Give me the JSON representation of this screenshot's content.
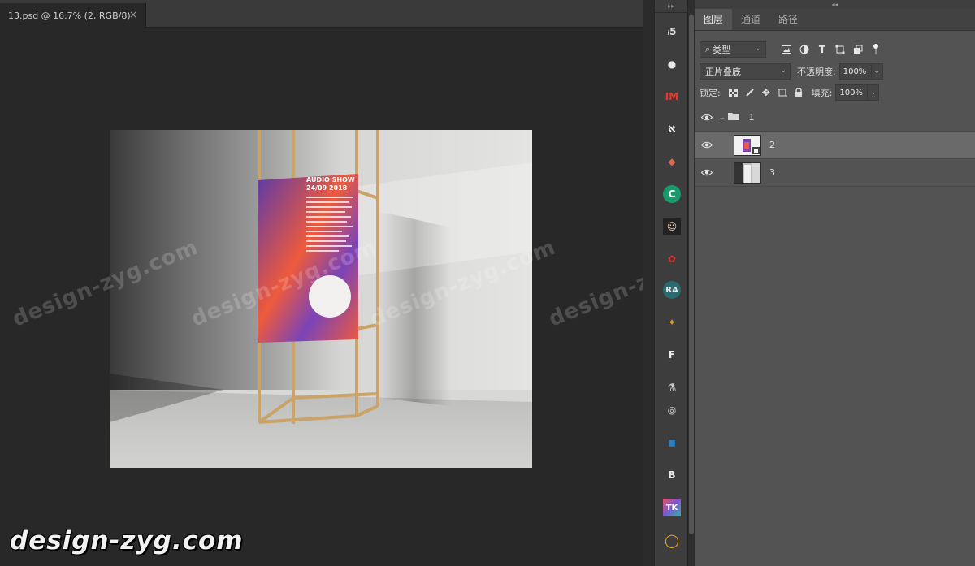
{
  "document": {
    "tab_label": "13.psd @ 16.7% (2, RGB/8)",
    "close_symbol": "×"
  },
  "artwork": {
    "poster_title": "AUDIO SHOW",
    "poster_date": "24/09 2018",
    "poster_colors": {
      "orange": "#ee5a3c",
      "purple": "#5b3aa8"
    }
  },
  "watermarks": {
    "text": "design-zyg.com",
    "main": "design-zyg.com"
  },
  "plugins": [
    {
      "name": "plugin-1",
      "glyph": "ᵢ5"
    },
    {
      "name": "plugin-2",
      "glyph": "●"
    },
    {
      "name": "plugin-im",
      "glyph": "IM"
    },
    {
      "name": "plugin-4",
      "glyph": "ℵ"
    },
    {
      "name": "plugin-5",
      "glyph": "◆"
    },
    {
      "name": "plugin-c",
      "glyph": "C"
    },
    {
      "name": "plugin-7",
      "glyph": "☺"
    },
    {
      "name": "plugin-8",
      "glyph": "✿"
    },
    {
      "name": "plugin-ra",
      "glyph": "RA"
    },
    {
      "name": "plugin-10",
      "glyph": "✦"
    },
    {
      "name": "plugin-11",
      "glyph": "F"
    },
    {
      "name": "plugin-12",
      "glyph": "⚗"
    },
    {
      "name": "plugin-13",
      "glyph": "◎"
    },
    {
      "name": "plugin-14",
      "glyph": "◼"
    },
    {
      "name": "plugin-b",
      "glyph": "B"
    },
    {
      "name": "plugin-tk",
      "glyph": "TK"
    },
    {
      "name": "plugin-17",
      "glyph": "◯"
    }
  ],
  "panel": {
    "tabs": [
      {
        "label": "图层",
        "active": true
      },
      {
        "label": "通道",
        "active": false
      },
      {
        "label": "路径",
        "active": false
      }
    ],
    "filter": {
      "search_glyph": "⌕",
      "type_label": "类型"
    },
    "blend_mode": "正片叠底",
    "opacity_label": "不透明度:",
    "opacity_value": "100%",
    "lock_label": "锁定:",
    "fill_label": "填充:",
    "fill_value": "100%",
    "layers": [
      {
        "name": "1",
        "kind": "group",
        "visible": true,
        "selected": false
      },
      {
        "name": "2",
        "kind": "smart-object",
        "visible": true,
        "selected": true
      },
      {
        "name": "3",
        "kind": "image",
        "visible": true,
        "selected": false
      }
    ]
  }
}
